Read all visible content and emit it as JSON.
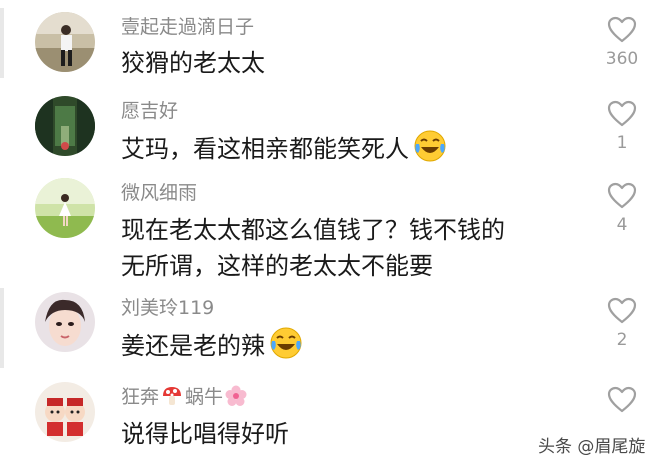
{
  "comments": [
    {
      "username": "壹起走過滴日子",
      "text": "狡猾的老太太",
      "likes": "360"
    },
    {
      "username": "愿吉好",
      "text": "艾玛，看这相亲都能笑死人",
      "likes": "1"
    },
    {
      "username": "微风细雨",
      "text_line1": "现在老太太都这么值钱了？钱不钱的",
      "text_line2": "无所谓，这样的老太太不能要",
      "likes": "4"
    },
    {
      "username": "刘美玲119",
      "text": "姜还是老的辣",
      "likes": "2"
    },
    {
      "username_part1": "狂奔",
      "username_part2": "蜗牛",
      "text": "说得比唱得好听",
      "likes": ""
    }
  ],
  "watermark": "头条 @眉尾旋",
  "icons": {
    "like": "heart-outline-icon",
    "emoji": "tears-of-joy-emoji",
    "mushroom": "mushroom-icon",
    "flower": "cherry-blossom-icon"
  },
  "colors": {
    "username": "#8a8a8a",
    "text": "#1a1a1a",
    "like_count": "#9a9a9a",
    "heart_stroke": "#a0a0a0"
  }
}
